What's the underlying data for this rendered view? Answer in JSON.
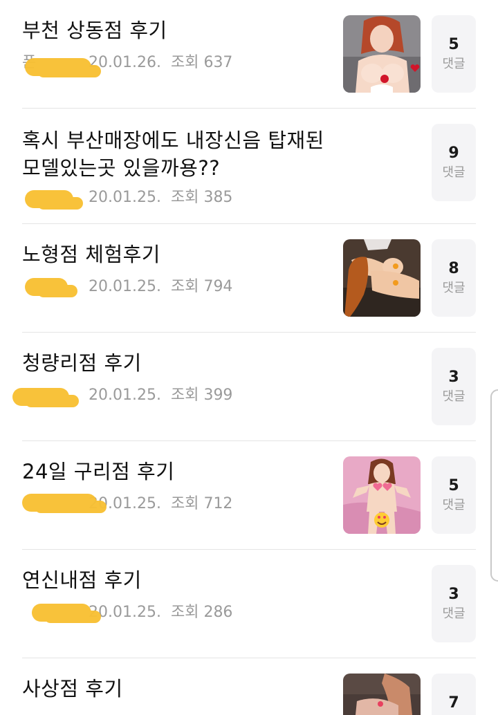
{
  "posts": [
    {
      "title": "부천 상동점 후기",
      "author": "폰",
      "date": "20.01.26.",
      "views": "조회 637",
      "comment_count": "5",
      "comment_label": "댓글",
      "has_thumbnail": true
    },
    {
      "title": "혹시 부산매장에도 내장신음 탑재된 모델있는곳 있을까용??",
      "author": "",
      "date": "20.01.25.",
      "views": "조회 385",
      "comment_count": "9",
      "comment_label": "댓글",
      "has_thumbnail": false
    },
    {
      "title": "노형점 체험후기",
      "author": "",
      "date": "20.01.25.",
      "views": "조회 794",
      "comment_count": "8",
      "comment_label": "댓글",
      "has_thumbnail": true
    },
    {
      "title": "청량리점 후기",
      "author": "",
      "date": "20.01.25.",
      "views": "조회 399",
      "comment_count": "3",
      "comment_label": "댓글",
      "has_thumbnail": false
    },
    {
      "title": "24일 구리점 후기",
      "author": "",
      "date": "20.01.25.",
      "views": "조회 712",
      "comment_count": "5",
      "comment_label": "댓글",
      "has_thumbnail": true
    },
    {
      "title": "연신내점 후기",
      "author": "",
      "date": "20.01.25.",
      "views": "조회 286",
      "comment_count": "3",
      "comment_label": "댓글",
      "has_thumbnail": false
    },
    {
      "title": "사상점 후기",
      "author": "",
      "date": "",
      "views": "",
      "comment_count": "7",
      "comment_label": "댓글",
      "has_thumbnail": true
    }
  ],
  "colors": {
    "redaction": "#f8c033",
    "meta_text": "#9a9a9a",
    "comment_box_bg": "#f4f4f6",
    "divider": "#e4e4e4"
  }
}
